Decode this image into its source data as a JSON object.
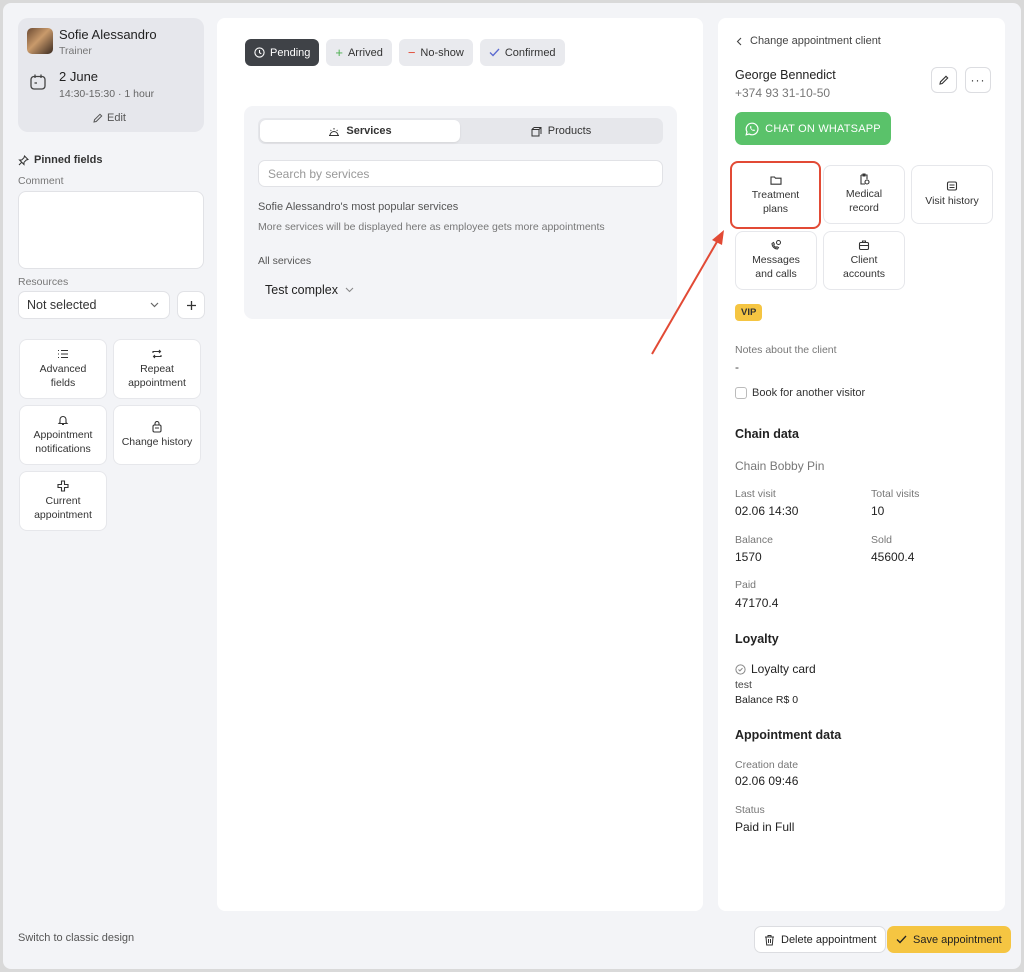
{
  "employee": {
    "name": "Sofie Alessandro",
    "role": "Trainer",
    "date": "2 June",
    "time": "14:30-15:30 · 1 hour",
    "edit_label": "Edit"
  },
  "left": {
    "pinned_label": "Pinned fields",
    "comment_label": "Comment",
    "resources_label": "Resources",
    "resources_value": "Not selected",
    "tiles": [
      {
        "label_1": "Advanced",
        "label_2": "fields"
      },
      {
        "label_1": "Repeat",
        "label_2": "appointment"
      },
      {
        "label_1": "Appointment",
        "label_2": "notifications"
      },
      {
        "label_1": "Change history",
        "label_2": ""
      },
      {
        "label_1": "Current",
        "label_2": "appointment"
      }
    ],
    "switch_label": "Switch to classic design"
  },
  "status": {
    "pending": "Pending",
    "arrived": "Arrived",
    "noshow": "No-show",
    "confirmed": "Confirmed"
  },
  "services": {
    "tab_services": "Services",
    "tab_products": "Products",
    "search_placeholder": "Search by services",
    "popular_title": "Sofie Alessandro's most popular services",
    "popular_desc": "More services will be displayed here as employee gets more appointments",
    "all_label": "All services",
    "group_name": "Test complex"
  },
  "client": {
    "back_label": "Change appointment client",
    "name": "George Bennedict",
    "phone": "+374 93 31-10-50",
    "whatsapp_label": "CHAT ON WHATSAPP",
    "actions": [
      {
        "label_1": "Treatment",
        "label_2": "plans"
      },
      {
        "label_1": "Medical",
        "label_2": "record"
      },
      {
        "label_1": "Visit history",
        "label_2": ""
      },
      {
        "label_1": "Messages",
        "label_2": "and calls"
      },
      {
        "label_1": "Client",
        "label_2": "accounts"
      }
    ],
    "vip": "VIP",
    "notes_label": "Notes about the client",
    "notes_value": "-",
    "book_other_label": "Book for another visitor",
    "chain": {
      "title": "Chain data",
      "name": "Chain Bobby Pin",
      "last_visit_label": "Last visit",
      "last_visit": "02.06 14:30",
      "total_visits_label": "Total visits",
      "total_visits": "10",
      "balance_label": "Balance",
      "balance": "1570",
      "sold_label": "Sold",
      "sold": "45600.4",
      "paid_label": "Paid",
      "paid": "47170.4"
    },
    "loyalty": {
      "title": "Loyalty",
      "card": "Loyalty card",
      "card_name": "test",
      "balance": "Balance R$ 0"
    },
    "appointment": {
      "title": "Appointment data",
      "creation_label": "Creation date",
      "creation": "02.06 09:46",
      "status_label": "Status",
      "status": "Paid in Full"
    }
  },
  "footer": {
    "delete_label": "Delete appointment",
    "save_label": "Save appointment"
  },
  "colors": {
    "accent_yellow": "#f5c542",
    "whatsapp_green": "#5ac26a",
    "highlight_red": "#e24a35",
    "pending_dark": "#3f4247"
  }
}
